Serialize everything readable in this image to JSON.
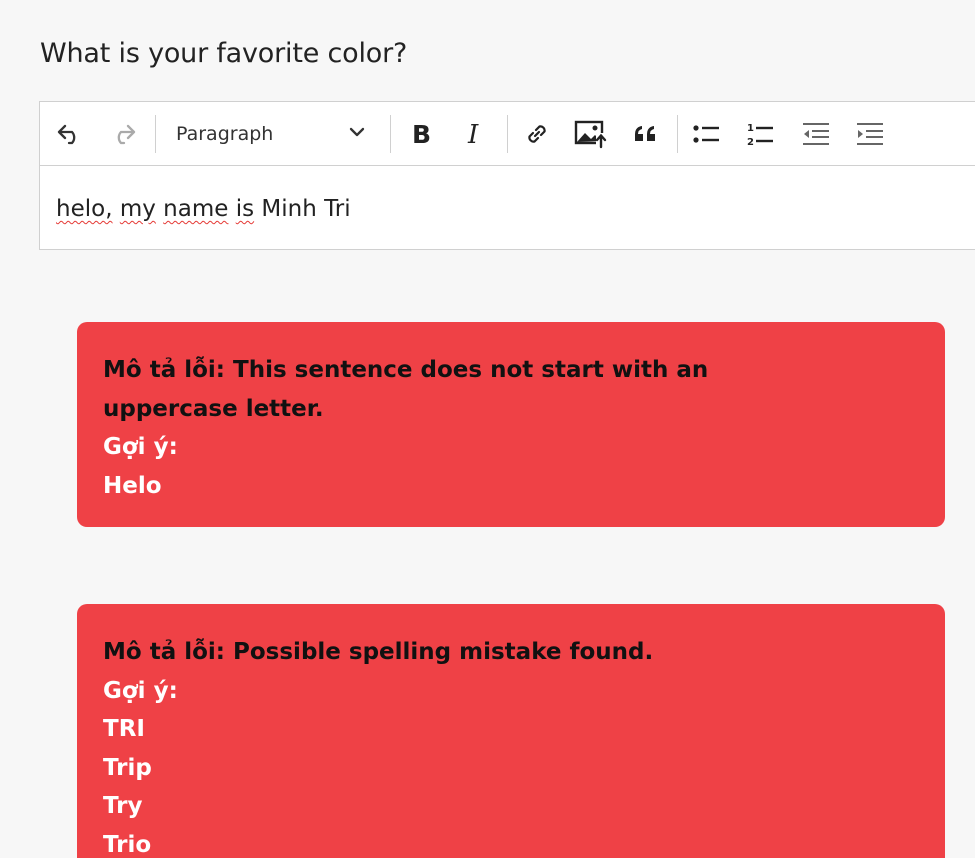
{
  "question": "What is your favorite color?",
  "toolbar": {
    "undo_icon": "undo-icon",
    "redo_icon": "redo-icon",
    "heading_value": "Paragraph",
    "bold_icon": "bold-icon",
    "italic_icon": "italic-icon",
    "link_icon": "link-icon",
    "image_icon": "image-upload-icon",
    "quote_icon": "blockquote-icon",
    "bullet_list_icon": "bulleted-list-icon",
    "numbered_list_icon": "numbered-list-icon",
    "outdent_icon": "outdent-icon",
    "indent_icon": "indent-icon"
  },
  "editor": {
    "words": [
      {
        "text": "helo,",
        "misspelled": true
      },
      {
        "text": " ",
        "misspelled": false
      },
      {
        "text": "my",
        "misspelled": true
      },
      {
        "text": " ",
        "misspelled": false
      },
      {
        "text": "name",
        "misspelled": true
      },
      {
        "text": " ",
        "misspelled": false
      },
      {
        "text": "is",
        "misspelled": true
      },
      {
        "text": " Minh Tri",
        "misspelled": false
      }
    ]
  },
  "errors": [
    {
      "label": "Mô tả lỗi:",
      "description": "This sentence does not start with an uppercase letter.",
      "suggestion_label": "Gợi ý:",
      "suggestions": [
        "Helo"
      ]
    },
    {
      "label": "Mô tả lỗi:",
      "description": "Possible spelling mistake found.",
      "suggestion_label": "Gợi ý:",
      "suggestions": [
        "TRI",
        "Trip",
        "Try",
        "Trio"
      ]
    }
  ],
  "colors": {
    "error_card_bg": "#ef4146",
    "page_bg": "#f7f7f7",
    "spell_underline": "#e53935"
  }
}
